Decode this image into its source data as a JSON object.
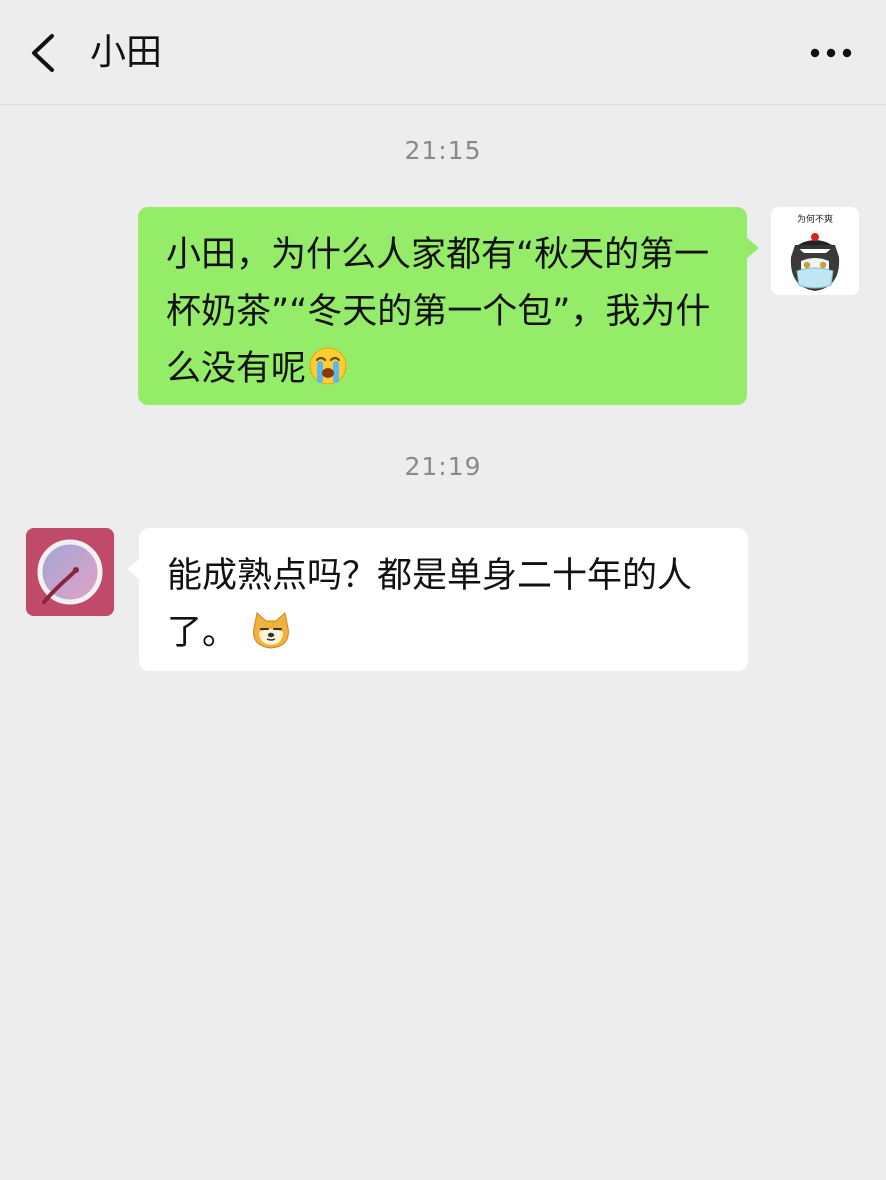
{
  "header": {
    "title": "小田",
    "back_icon": "chevron-left-icon",
    "more_icon": "ellipsis-icon"
  },
  "messages": [
    {
      "timestamp": "21:15",
      "sender": "me",
      "text": "小田，为什么人家都有“秋天的第一杯奶茶”“冬天的第一个包”，我为什么没有呢",
      "emoji": "crying-face-icon",
      "bubble_color": "#95ec69",
      "avatar_caption": "为何不爽"
    },
    {
      "timestamp": "21:19",
      "sender": "other",
      "text": "能成熟点吗？都是单身二十年的人了。",
      "emoji": "doge-icon",
      "bubble_color": "#ffffff"
    }
  ],
  "colors": {
    "background": "#ededed",
    "timestamp": "#8a8a8a"
  }
}
